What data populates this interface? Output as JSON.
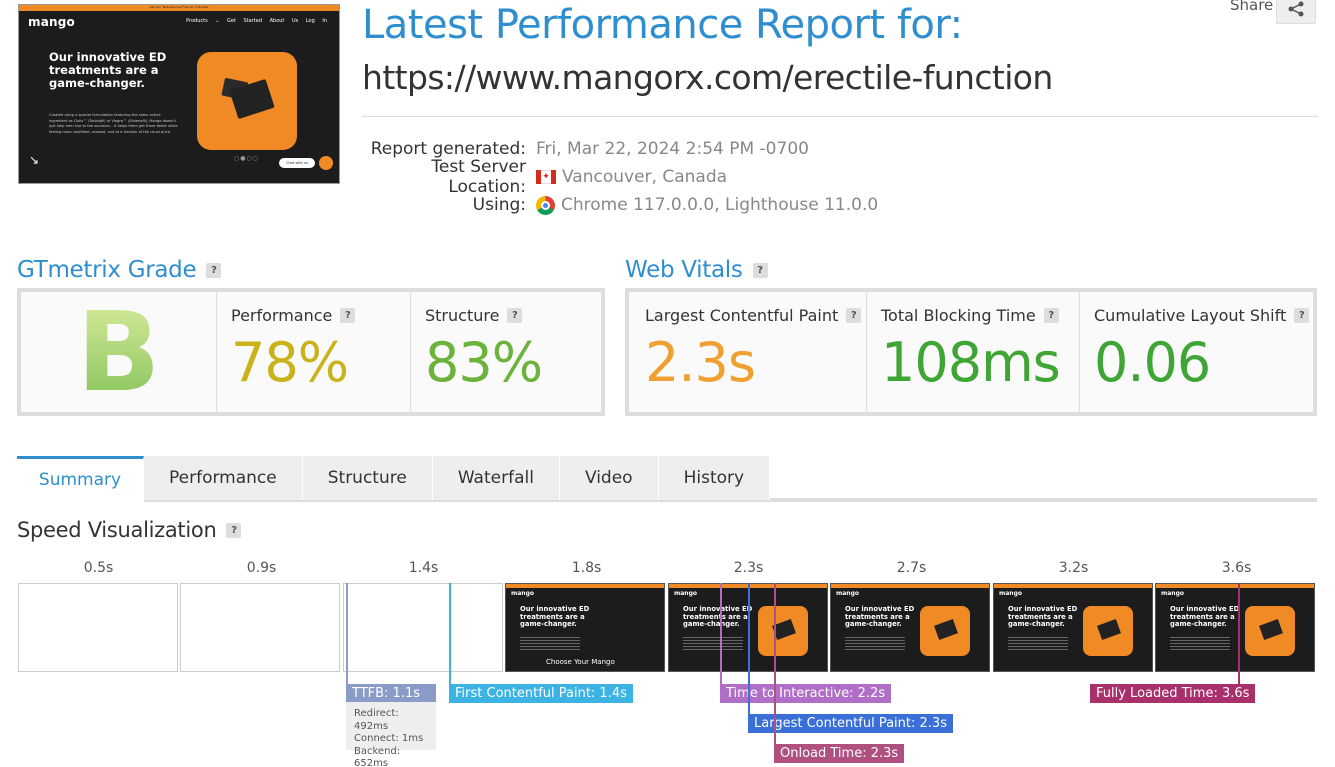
{
  "thumbnail": {
    "banner": "Get Our Testosterone Free for 3 Months",
    "logo": "mango",
    "nav": "Products ⌄  Get Started  About Us  Log In",
    "headline": "Our innovative ED treatments are a game-changer.",
    "body": "Created using a special formulation featuring the same active ingredient as Cialis™ (Tadalafil) or Viagra™ (Sildenafil), Mango doesn't just help men rise to the occasion – it helps them get there faster while feeling more confident, relaxed, and at a fraction of the usual price.",
    "chat": "Chat with us",
    "dots": "○●○○"
  },
  "header": {
    "title": "Latest Performance Report for:",
    "url": "https://www.mangorx.com/erectile-function",
    "share_label": "Share"
  },
  "meta": {
    "report_generated_label": "Report generated:",
    "report_generated_value": "Fri, Mar 22, 2024 2:54 PM -0700",
    "server_label": "Test Server Location:",
    "server_value": "Vancouver, Canada",
    "using_label": "Using:",
    "using_value": "Chrome 117.0.0.0, Lighthouse 11.0.0"
  },
  "grade": {
    "heading": "GTmetrix Grade",
    "letter": "B",
    "performance_label": "Performance",
    "performance_value": "78%",
    "structure_label": "Structure",
    "structure_value": "83%",
    "help": "?"
  },
  "vitals": {
    "heading": "Web Vitals",
    "lcp_label": "Largest Contentful Paint",
    "lcp_value": "2.3s",
    "tbt_label": "Total Blocking Time",
    "tbt_value": "108ms",
    "cls_label": "Cumulative Layout Shift",
    "cls_value": "0.06"
  },
  "tabs": [
    "Summary",
    "Performance",
    "Structure",
    "Waterfall",
    "Video",
    "History"
  ],
  "speed": {
    "heading": "Speed Visualization",
    "times": [
      "0.5s",
      "0.9s",
      "1.4s",
      "1.8s",
      "2.3s",
      "2.7s",
      "3.2s",
      "3.6s"
    ],
    "frame_headline": "Our innovative ED treatments are a game-changer.",
    "frame_caption": "Choose Your Mango",
    "ttfb": "TTFB: 1.1s",
    "ttfb_redirect": "Redirect: 492ms",
    "ttfb_connect": "Connect: 1ms",
    "ttfb_backend": "Backend: 652ms",
    "fcp": "First Contentful Paint: 1.4s",
    "tti": "Time to Interactive: 2.2s",
    "lcp": "Largest Contentful Paint: 2.3s",
    "onload": "Onload Time: 2.3s",
    "fully_loaded": "Fully Loaded Time: 3.6s"
  },
  "colors": {
    "accent": "#2e8ecf",
    "performance": "#c9b21a",
    "structure": "#6bb33a",
    "lcp": "#f0a030",
    "good": "#3fa535",
    "ttfb": "#8b9bc7",
    "fcp": "#3db3e3",
    "tti": "#b06ec7",
    "lcp_marker": "#3a6fd8",
    "onload": "#b05080",
    "fully": "#a8306b"
  }
}
